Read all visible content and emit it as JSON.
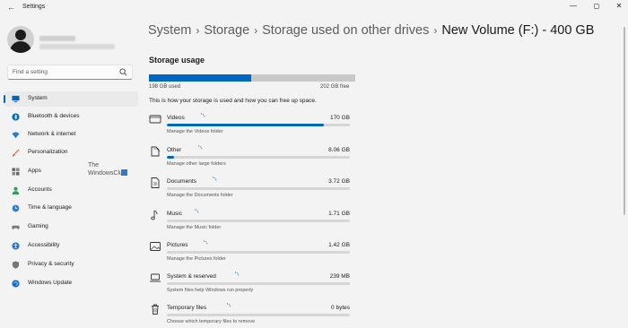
{
  "app": {
    "title": "Settings"
  },
  "window_controls": {
    "minimize": "—",
    "maximize": "◻",
    "close": "✕"
  },
  "sidebar": {
    "search_placeholder": "Find a setting",
    "items": [
      {
        "label": "System",
        "icon": "system-icon",
        "active": true
      },
      {
        "label": "Bluetooth & devices",
        "icon": "bluetooth-icon"
      },
      {
        "label": "Network & internet",
        "icon": "network-icon"
      },
      {
        "label": "Personalization",
        "icon": "brush-icon"
      },
      {
        "label": "Apps",
        "icon": "apps-icon"
      },
      {
        "label": "Accounts",
        "icon": "account-icon"
      },
      {
        "label": "Time & language",
        "icon": "globe-clock-icon"
      },
      {
        "label": "Gaming",
        "icon": "gamepad-icon"
      },
      {
        "label": "Accessibility",
        "icon": "accessibility-icon"
      },
      {
        "label": "Privacy & security",
        "icon": "shield-icon"
      },
      {
        "label": "Windows Update",
        "icon": "update-icon"
      }
    ]
  },
  "watermark": {
    "line1": "The",
    "line2": "WindowsClub"
  },
  "breadcrumb": {
    "items": [
      "System",
      "Storage",
      "Storage used on other drives"
    ],
    "current": "New Volume (F:) - 400 GB"
  },
  "storage": {
    "title": "Storage usage",
    "used_label": "198 GB used",
    "free_label": "202 GB free",
    "used_fraction": 0.495,
    "description": "This is how your storage is used and how you can free up space.",
    "categories": [
      {
        "name": "Videos",
        "size": "170 GB",
        "subtitle": "Manage the Videos folder",
        "fraction": 0.86,
        "icon": "video-icon"
      },
      {
        "name": "Other",
        "size": "8.06 GB",
        "subtitle": "Manage other large folders",
        "fraction": 0.04,
        "icon": "other-files-icon"
      },
      {
        "name": "Documents",
        "size": "3.72 GB",
        "subtitle": "Manage the Documents folder",
        "fraction": 0.0,
        "icon": "document-icon"
      },
      {
        "name": "Music",
        "size": "1.71 GB",
        "subtitle": "Manage the Music folder",
        "fraction": 0.0,
        "icon": "music-icon"
      },
      {
        "name": "Pictures",
        "size": "1.42 GB",
        "subtitle": "Manage the Pictures folder",
        "fraction": 0.0,
        "icon": "picture-icon"
      },
      {
        "name": "System & reserved",
        "size": "239 MB",
        "subtitle": "System files help Windows run properly",
        "fraction": 0.0,
        "icon": "laptop-icon"
      },
      {
        "name": "Temporary files",
        "size": "0 bytes",
        "subtitle": "Choose which temporary files to remove",
        "fraction": 0.0,
        "icon": "trash-icon"
      }
    ]
  },
  "colors": {
    "accent": "#0067c0",
    "bar_track": "#d6d6d6"
  }
}
